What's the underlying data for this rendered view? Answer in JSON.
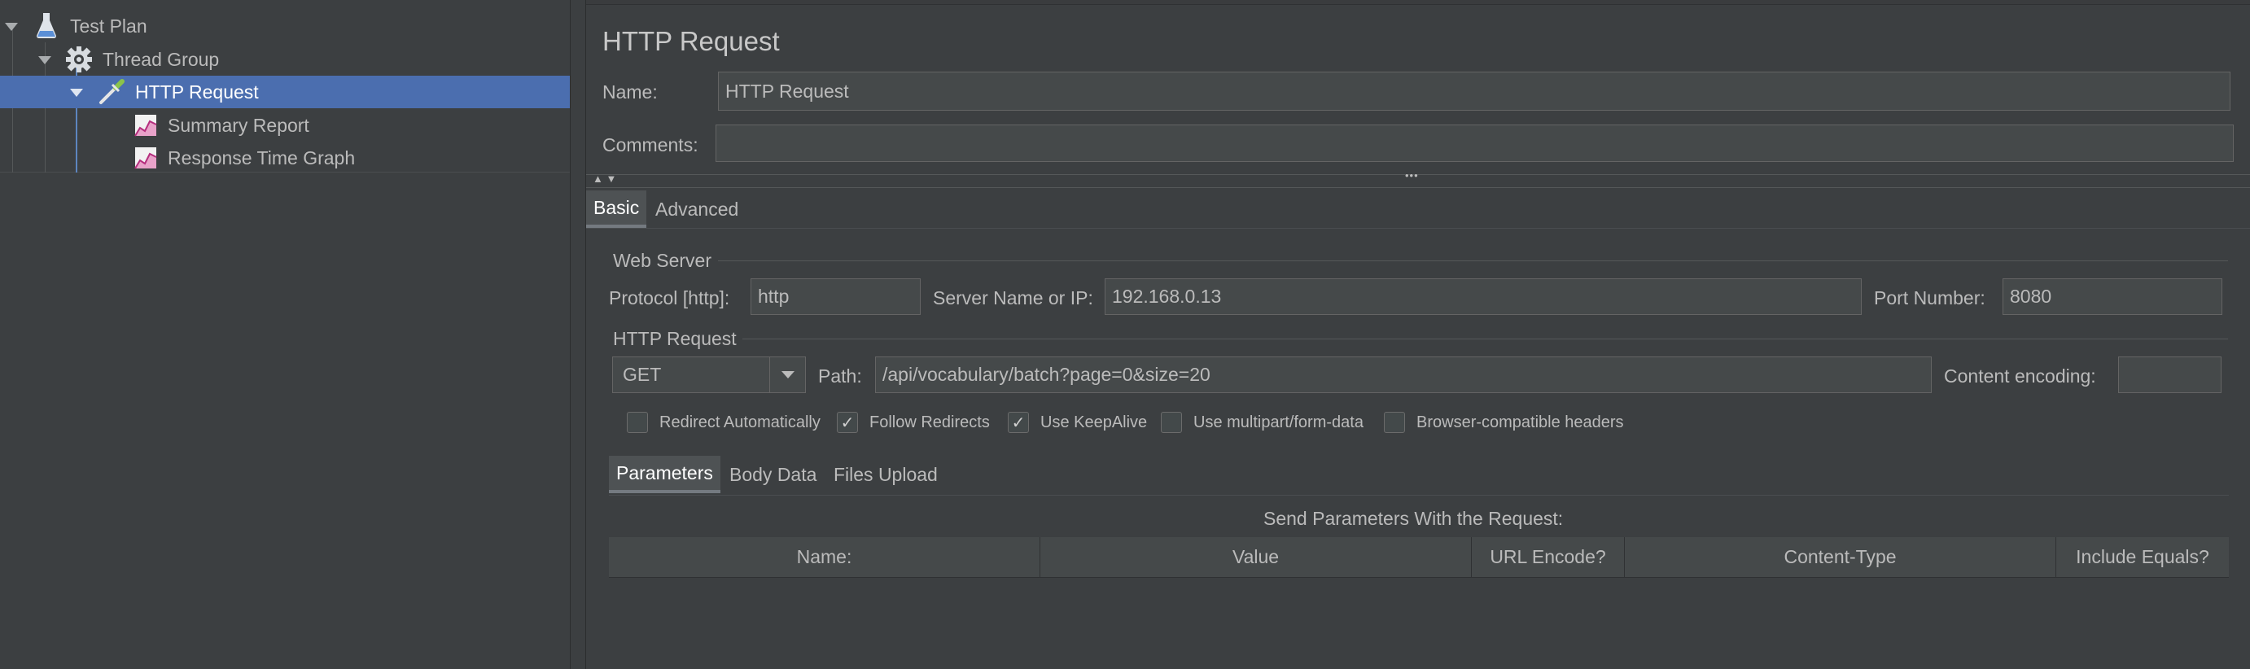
{
  "tree": {
    "items": [
      {
        "label": "Test Plan",
        "icon": "flask-icon"
      },
      {
        "label": "Thread Group",
        "icon": "gear-icon"
      },
      {
        "label": "HTTP Request",
        "icon": "pipette-icon",
        "selected": true
      },
      {
        "label": "Summary Report",
        "icon": "graph-icon"
      },
      {
        "label": "Response Time Graph",
        "icon": "graph-icon"
      }
    ]
  },
  "panel": {
    "title": "HTTP Request",
    "name_label": "Name:",
    "name_value": "HTTP Request",
    "comments_label": "Comments:",
    "comments_value": "",
    "splitter_dots": "•••"
  },
  "tabs": {
    "basic": "Basic",
    "advanced": "Advanced"
  },
  "web_server": {
    "section_title": "Web Server",
    "protocol_label": "Protocol [http]:",
    "protocol_value": "http",
    "server_label": "Server Name or IP:",
    "server_value": "192.168.0.13",
    "port_label": "Port Number:",
    "port_value": "8080"
  },
  "http_request": {
    "section_title": "HTTP Request",
    "method_value": "GET",
    "path_label": "Path:",
    "path_value": "/api/vocabulary/batch?page=0&size=20",
    "encoding_label": "Content encoding:",
    "encoding_value": ""
  },
  "options": [
    {
      "label": "Redirect Automatically",
      "checked": false
    },
    {
      "label": "Follow Redirects",
      "checked": true
    },
    {
      "label": "Use KeepAlive",
      "checked": true
    },
    {
      "label": "Use multipart/form-data",
      "checked": false
    },
    {
      "label": "Browser-compatible headers",
      "checked": false
    }
  ],
  "sub_tabs": {
    "parameters": "Parameters",
    "body_data": "Body Data",
    "files_upload": "Files Upload"
  },
  "params_table": {
    "caption": "Send Parameters With the Request:",
    "columns": [
      "Name:",
      "Value",
      "URL Encode?",
      "Content-Type",
      "Include Equals?"
    ]
  },
  "colors": {
    "background": "#3c3f41",
    "selection": "#4b6eaf",
    "field": "#45494a"
  }
}
